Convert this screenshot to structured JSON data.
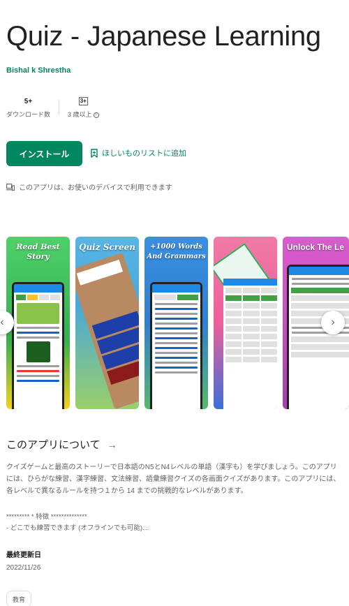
{
  "app": {
    "title": "Quiz - Japanese Learning",
    "developer": "Bishal k Shrestha"
  },
  "stats": {
    "downloads_value": "5+",
    "downloads_label": "ダウンロード数",
    "rating_badge": "3+",
    "rating_label": "3 歳以上"
  },
  "actions": {
    "install_label": "インストール",
    "wishlist_label": "ほしいものリストに追加",
    "device_note": "このアプリは、お使いのデバイスで利用できます"
  },
  "screenshots": [
    {
      "title": "Read Best Story",
      "color": "#3fbf5a"
    },
    {
      "title": "Quiz Screen",
      "color": "#4aa8d8"
    },
    {
      "title": "+1000 Words And Grammars",
      "color": "#2f80d1"
    },
    {
      "title": "",
      "color": "#ee5f9a"
    },
    {
      "title": "Unlock The Le",
      "color": "#c94ec1"
    }
  ],
  "about": {
    "heading": "このアプリについて",
    "description": "クイズゲームと最高のストーリーで日本語のN5とN4レベルの単語（漢字も）を学びましょう。このアプリには、ひらがな練習、漢字練習、文法練習、語彙練習クイズの各画面クイズがあります。このアプリには、各レベルで異なるルールを持つ１から 14 までの挑戦的なレベルがあります。",
    "features_line1": "********* * 特徴 **************",
    "features_line2": "- どこでも練習できます (オフラインでも可能)..."
  },
  "updated": {
    "label": "最終更新日",
    "date": "2022/11/26"
  },
  "category_chip": "教育",
  "colors": {
    "brand_green": "#01875f"
  }
}
